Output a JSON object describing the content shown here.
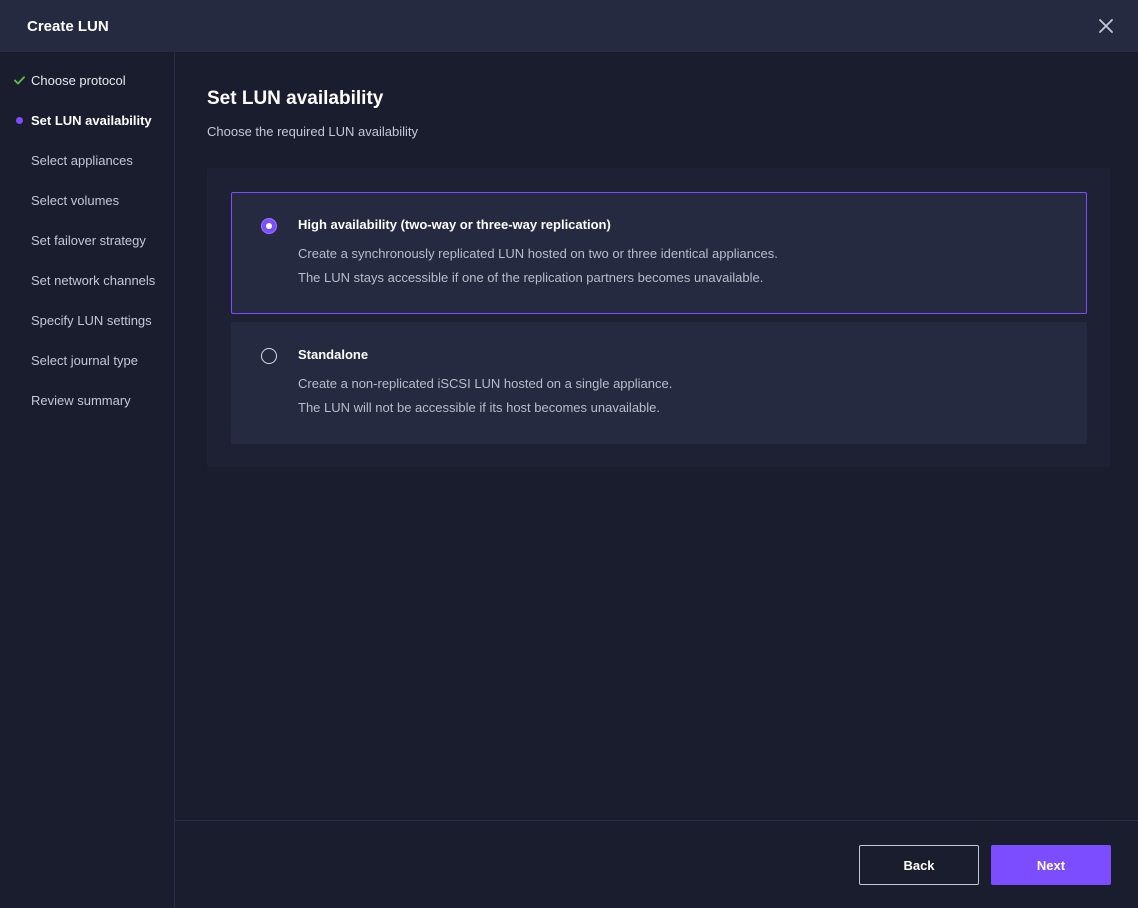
{
  "dialog": {
    "title": "Create LUN"
  },
  "sidebar": {
    "steps": [
      {
        "label": "Choose protocol",
        "state": "done"
      },
      {
        "label": "Set LUN availability",
        "state": "active"
      },
      {
        "label": "Select appliances",
        "state": "pending"
      },
      {
        "label": "Select volumes",
        "state": "pending"
      },
      {
        "label": "Set failover strategy",
        "state": "pending"
      },
      {
        "label": "Set network channels",
        "state": "pending"
      },
      {
        "label": "Specify LUN settings",
        "state": "pending"
      },
      {
        "label": "Select journal type",
        "state": "pending"
      },
      {
        "label": "Review summary",
        "state": "pending"
      }
    ]
  },
  "main": {
    "title": "Set LUN availability",
    "subtitle": "Choose the required LUN availability",
    "options": [
      {
        "title": "High availability (two-way or three-way replication)",
        "line1": "Create a synchronously replicated LUN hosted on two or three identical appliances.",
        "line2": "The LUN stays accessible if one of the replication partners becomes unavailable.",
        "selected": true
      },
      {
        "title": "Standalone",
        "line1": "Create a non-replicated iSCSI LUN hosted on a single appliance.",
        "line2": "The LUN will not be accessible if its host becomes unavailable.",
        "selected": false
      }
    ]
  },
  "footer": {
    "back_label": "Back",
    "next_label": "Next"
  },
  "icons": {
    "close": "close-icon",
    "done": "check-icon",
    "active": "dot-icon"
  },
  "colors": {
    "accent": "#7b4dff",
    "done": "#5ec24a",
    "background": "#1a1d2e",
    "panel": "#252a40"
  }
}
